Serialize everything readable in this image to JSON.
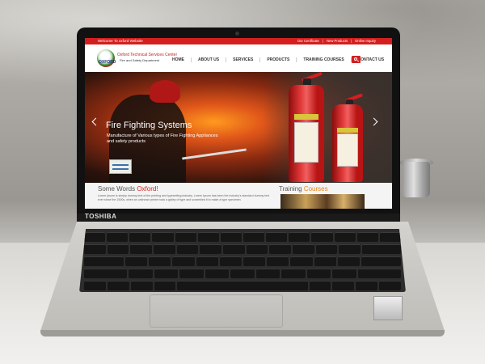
{
  "laptop": {
    "brand": "TOSHIBA"
  },
  "website": {
    "topbar": {
      "welcome": "Welcome To oxford Website",
      "links": [
        "Our Certificate",
        "New Products",
        "Online Inquiry"
      ]
    },
    "logo": {
      "text": "OXFORD",
      "company_name": "Oxford Technical Services Center",
      "department": "Fire and Safety Department"
    },
    "nav": [
      "HOME",
      "ABOUT US",
      "SERVICES",
      "PRODUCTS",
      "TRAINING COURSES",
      "CONTACT US"
    ],
    "hero": {
      "title": "Fire Fighting Systems",
      "subtitle": "Manufacture of Various types of Fire Fighting Appliances and safety products"
    },
    "some_words": {
      "title_prefix": "Some Words ",
      "title_highlight": "Oxford!",
      "body": "Lorem Ipsum is simply dummy text of the printing and typesetting industry. Lorem Ipsum has been the industry's standard dummy text ever since the 1500s, when an unknown printer took a galley of type and scrambled it to make a type specimen"
    },
    "training": {
      "title_prefix": "Training ",
      "title_highlight": "Courses"
    },
    "colors": {
      "accent_red": "#d31f1f",
      "accent_orange": "#e8841a"
    }
  }
}
